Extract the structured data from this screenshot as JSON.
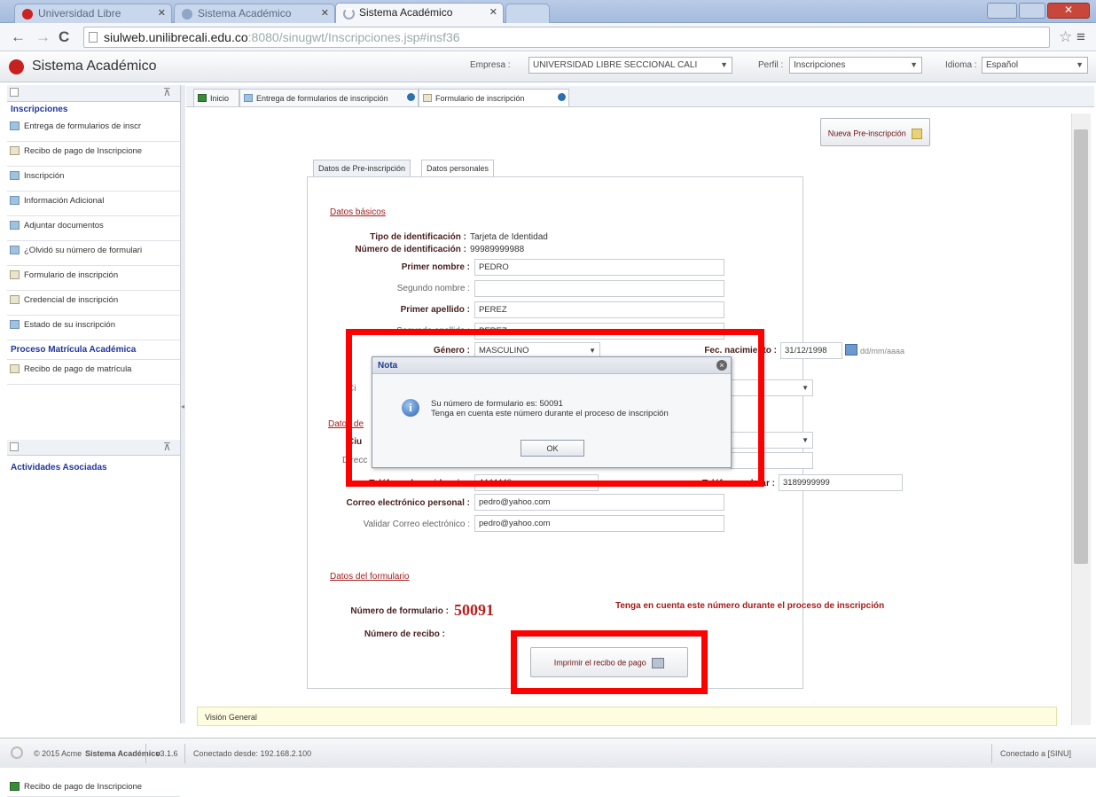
{
  "browser": {
    "tabs": [
      {
        "label": "Universidad Libre"
      },
      {
        "label": "Sistema Académico"
      },
      {
        "label": "Sistema Académico"
      }
    ],
    "url_host": "siulweb.unilibrecali.edu.co",
    "url_path": ":8080/sinugwt/Inscripciones.jsp#insf36"
  },
  "header": {
    "title": "Sistema Académico",
    "empresa_label": "Empresa :",
    "empresa_value": "UNIVERSIDAD LIBRE SECCIONAL CALI",
    "perfil_label": "Perfil :",
    "perfil_value": "Inscripciones",
    "idioma_label": "Idioma :",
    "idioma_value": "Español"
  },
  "sidebar": {
    "section1": "Inscripciones",
    "items": [
      "Entrega de formularios de inscr",
      "Recibo de pago de Inscripcione",
      "Inscripción",
      "Información Adicional",
      "Adjuntar documentos",
      "¿Olvidó su número de formulari",
      "Formulario de inscripción",
      "Credencial de inscripción",
      "Estado de su inscripción"
    ],
    "section2": "Proceso Matrícula Académica",
    "items2": [
      "Recibo de pago de matrícula"
    ],
    "section3": "Actividades Asociadas",
    "items3": [
      "Recibo de pago de Inscripcione"
    ]
  },
  "tabs": [
    "Inicio",
    "Entrega de formularios de inscripción",
    "Formulario de inscripción"
  ],
  "actions": {
    "new_pre": "Nueva Pre-inscripción",
    "print": "Imprimir el recibo de pago"
  },
  "form_tabs": [
    "Datos de Pre-inscripción",
    "Datos personales"
  ],
  "form": {
    "basic_title": "Datos básicos",
    "tipo_label": "Tipo de identificación :",
    "tipo_value": "Tarjeta de Identidad",
    "numero_label": "Número de identificación :",
    "numero_value": "99989999988",
    "primer_nombre_label": "Primer nombre :",
    "primer_nombre": "PEDRO",
    "segundo_nombre_label": "Segundo nombre :",
    "segundo_nombre": "",
    "primer_apellido_label": "Primer apellido :",
    "primer_apellido": "PEREZ",
    "segundo_apellido_label": "Segundo apellido :",
    "segundo_apellido": "PEREZ",
    "genero_label": "Género :",
    "genero": "MASCULINO",
    "fec_label": "Fec. nacimiento :",
    "fec_value": "31/12/1998",
    "fec_hint": "dd/mm/aaaa",
    "ciudad_label_short": "Ci",
    "datos_label_short": "Datos de",
    "ciudad_label2_short": "Ciu",
    "direccion_label_short": "Direcc",
    "tel_res_label": "Teléfono de residencia :",
    "tel_res": "4444440",
    "tel_cel_label": "Teléfono celular :",
    "tel_cel": "3189999999",
    "correo_label": "Correo electrónico personal :",
    "correo": "pedro@yahoo.com",
    "validar_label": "Validar Correo electrónico :",
    "validar": "pedro@yahoo.com",
    "formulario_title": "Datos del formulario",
    "num_form_label": "Número de formulario :",
    "num_form": "50091",
    "note": "Tenga en cuenta este número durante el proceso de inscripción",
    "num_recibo_label": "Número de recibo :"
  },
  "dialog": {
    "title": "Nota",
    "line1": "Su número de formulario es: 50091",
    "line2": "Tenga en cuenta este número durante el proceso de inscripción",
    "ok": "OK"
  },
  "bottom": {
    "vision": "Visión General"
  },
  "status": {
    "copyright": "© 2015 Acme",
    "app": "Sistema Académico",
    "version": "v3.1.6",
    "connected_from": "Conectado desde: 192.168.2.100",
    "connected_to": "Conectado a [SINU]"
  },
  "colors": {
    "accent": "#22379a",
    "label_red": "#a41c1c",
    "highlight": "#ff0000"
  }
}
